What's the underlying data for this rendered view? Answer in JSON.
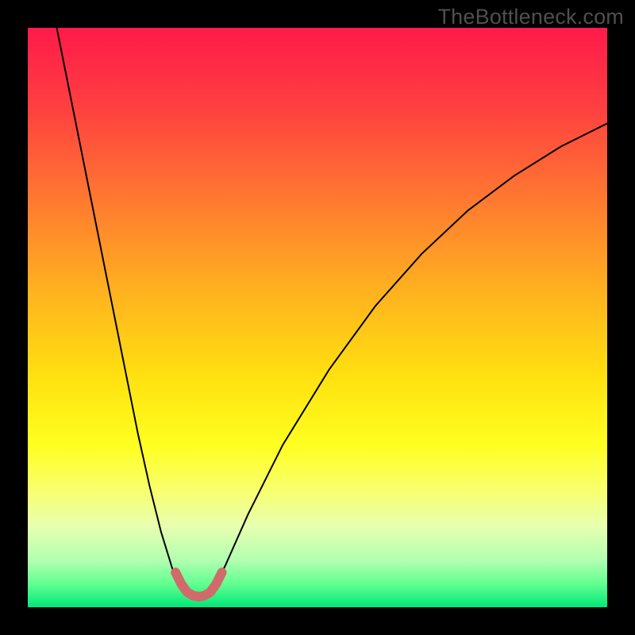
{
  "watermark": "TheBottleneck.com",
  "chart_data": {
    "type": "line",
    "title": "",
    "xlabel": "",
    "ylabel": "",
    "xlim": [
      0,
      100
    ],
    "ylim": [
      0,
      100
    ],
    "background_gradient": {
      "stops": [
        {
          "offset": 0.0,
          "color": "#ff1a4a"
        },
        {
          "offset": 0.14,
          "color": "#ff4040"
        },
        {
          "offset": 0.3,
          "color": "#ff7a30"
        },
        {
          "offset": 0.45,
          "color": "#ffb020"
        },
        {
          "offset": 0.6,
          "color": "#ffe010"
        },
        {
          "offset": 0.72,
          "color": "#ffff20"
        },
        {
          "offset": 0.8,
          "color": "#f8ff70"
        },
        {
          "offset": 0.86,
          "color": "#e8ffb0"
        },
        {
          "offset": 0.92,
          "color": "#b0ffb0"
        },
        {
          "offset": 0.96,
          "color": "#60ff90"
        },
        {
          "offset": 1.0,
          "color": "#00e878"
        }
      ]
    },
    "series": [
      {
        "name": "bottleneck-curve",
        "stroke": "#000000",
        "stroke_width": 2.0,
        "points": [
          {
            "x": 5.0,
            "y": 100.0
          },
          {
            "x": 7.0,
            "y": 90.0
          },
          {
            "x": 9.0,
            "y": 80.0
          },
          {
            "x": 11.0,
            "y": 70.0
          },
          {
            "x": 13.0,
            "y": 60.0
          },
          {
            "x": 15.0,
            "y": 50.0
          },
          {
            "x": 17.0,
            "y": 40.0
          },
          {
            "x": 19.0,
            "y": 30.0
          },
          {
            "x": 21.0,
            "y": 21.0
          },
          {
            "x": 23.0,
            "y": 13.0
          },
          {
            "x": 25.0,
            "y": 6.5
          },
          {
            "x": 27.0,
            "y": 2.5
          },
          {
            "x": 28.5,
            "y": 1.5
          },
          {
            "x": 30.0,
            "y": 1.5
          },
          {
            "x": 31.5,
            "y": 2.5
          },
          {
            "x": 34.0,
            "y": 7.0
          },
          {
            "x": 38.0,
            "y": 16.0
          },
          {
            "x": 44.0,
            "y": 28.0
          },
          {
            "x": 52.0,
            "y": 41.0
          },
          {
            "x": 60.0,
            "y": 52.0
          },
          {
            "x": 68.0,
            "y": 61.0
          },
          {
            "x": 76.0,
            "y": 68.5
          },
          {
            "x": 84.0,
            "y": 74.5
          },
          {
            "x": 92.0,
            "y": 79.5
          },
          {
            "x": 100.0,
            "y": 83.5
          }
        ]
      },
      {
        "name": "sweet-spot-marker",
        "stroke": "#d16a6a",
        "stroke_width": 12.0,
        "linecap": "round",
        "points": [
          {
            "x": 25.5,
            "y": 6.0
          },
          {
            "x": 26.5,
            "y": 4.0
          },
          {
            "x": 27.5,
            "y": 2.6
          },
          {
            "x": 28.5,
            "y": 2.0
          },
          {
            "x": 29.5,
            "y": 1.8
          },
          {
            "x": 30.5,
            "y": 2.0
          },
          {
            "x": 31.5,
            "y": 2.6
          },
          {
            "x": 32.5,
            "y": 4.0
          },
          {
            "x": 33.5,
            "y": 6.0
          }
        ]
      }
    ]
  }
}
